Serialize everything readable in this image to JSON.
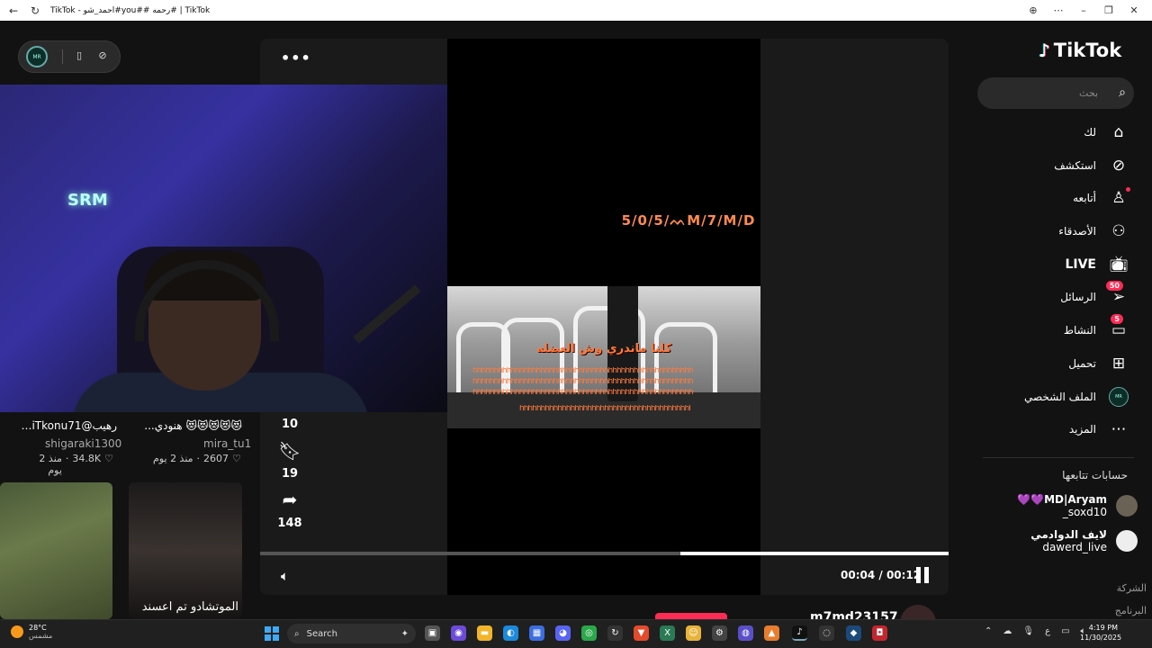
{
  "browser": {
    "title": "TikTok - احمد_شو#you## رحمه# | TikTok",
    "back_icon": "back-arrow-icon",
    "reload_icon": "reload-icon",
    "controls": [
      "⊕",
      "⋯",
      "–",
      "❐",
      "✕"
    ]
  },
  "left_panel": {
    "pill_avatar_text": "MR",
    "items": [
      {
        "title": "رهيب@EiTkonu71...",
        "user": "shigaraki1300",
        "likes": "34.8K",
        "age": "منذ 2 يوم"
      },
      {
        "title": "😻😻😻😻😻 هنودي...",
        "user": "mira_tu1",
        "likes": "2607",
        "age": "منذ 2 يوم"
      }
    ],
    "thumb2_caption": "الموتشادو تم اعسند"
  },
  "player": {
    "more_label": "•••",
    "date_overlay": "5/0/5/ᨓM/7/M/D",
    "caption_line1": "كلنا ماندري وش العضله",
    "strike_text": "hhhhhhhhhhhhhhhhhhhhhhhhhhhhhhhhhhhhhhhhhhhhhhhhhhhh",
    "actions": {
      "comments_count": "10",
      "saves_count": "19",
      "shares_count": "148"
    },
    "progress": 0.61,
    "time_current": "00:04",
    "time_total": "00:12",
    "author": "m7md23157"
  },
  "sidebar": {
    "logo_text": "TikTok",
    "search_placeholder": "بحث",
    "nav": [
      {
        "label": "لك",
        "icon": "home-icon"
      },
      {
        "label": "استكشف",
        "icon": "compass-icon"
      },
      {
        "label": "أتابعه",
        "icon": "following-icon"
      },
      {
        "label": "الأصدقاء",
        "icon": "friends-icon"
      },
      {
        "label": "LIVE",
        "icon": "live-icon"
      },
      {
        "label": "الرسائل",
        "icon": "messages-icon",
        "badge": "50"
      },
      {
        "label": "النشاط",
        "icon": "activity-icon",
        "badge": "5"
      },
      {
        "label": "تحميل",
        "icon": "upload-icon"
      },
      {
        "label": "الملف الشخصي",
        "icon": "profile-avatar"
      },
      {
        "label": "المزيد",
        "icon": "more-icon"
      }
    ],
    "following_title": "حسابات تتابعها",
    "accounts": [
      {
        "name": "💜💜MD|Aryam",
        "handle": "_soxd10"
      },
      {
        "name": "لايف الدوادمي",
        "handle": "dawerd_live"
      }
    ],
    "footer_company": "الشركة",
    "footer_program": "البرنامج"
  },
  "taskbar": {
    "temp": "28°C",
    "weather": "مشمس",
    "search_label": "Search",
    "lang": "ع",
    "time": "4:19 PM",
    "date": "11/30/2025"
  },
  "colors": {
    "accent": "#fe2c55",
    "bg": "#121212",
    "caption": "#ff7a3d"
  }
}
